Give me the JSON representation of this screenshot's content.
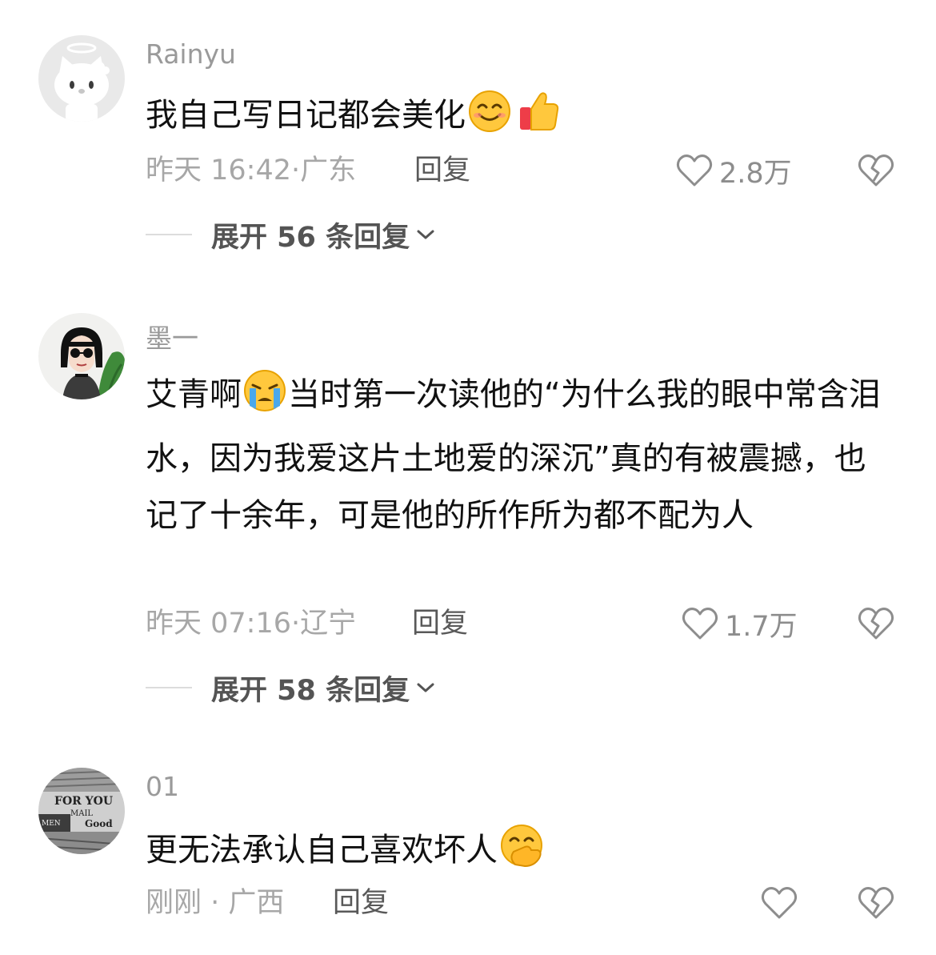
{
  "comments": [
    {
      "username": "Rainyu",
      "avatar_icon": "hello-kitty-avatar-icon",
      "text": "我自己写日记都会美化",
      "emojis": [
        "smiling-face-icon",
        "thumbs-up-icon"
      ],
      "time": "昨天 16:42",
      "location": "广东",
      "reply_label": "回复",
      "likes": "2.8万",
      "expand_label": "展开 56 条回复"
    },
    {
      "username": "墨一",
      "avatar_icon": "woman-sunglasses-avatar-icon",
      "text_prefix": "艾青啊",
      "emojis": [
        "crying-face-icon"
      ],
      "text": "当时第一次读他的“为什么我的眼中常含泪水，因为我爱这片土地爱的深沉”真的有被震撼，也记了十余年，可是他的所作所为都不配为人",
      "time": "昨天 07:16",
      "location": "辽宁",
      "reply_label": "回复",
      "likes": "1.7万",
      "expand_label": "展开 58 条回复"
    },
    {
      "username": "01",
      "avatar_icon": "newspaper-collage-avatar-icon",
      "text": "更无法承认自己喜欢坏人",
      "emojis": [
        "hand-over-mouth-face-icon"
      ],
      "time": "刚刚",
      "location": "广西",
      "reply_label": "回复",
      "likes": ""
    }
  ],
  "avatar_texts": [
    "FOR YOU",
    "MAIL",
    "Good",
    "MEN"
  ],
  "colors": {
    "username": "#9a9a9a",
    "meta": "#a7a7a7",
    "reply": "#595959",
    "icon": "#8d8d8d",
    "text": "#111111"
  }
}
